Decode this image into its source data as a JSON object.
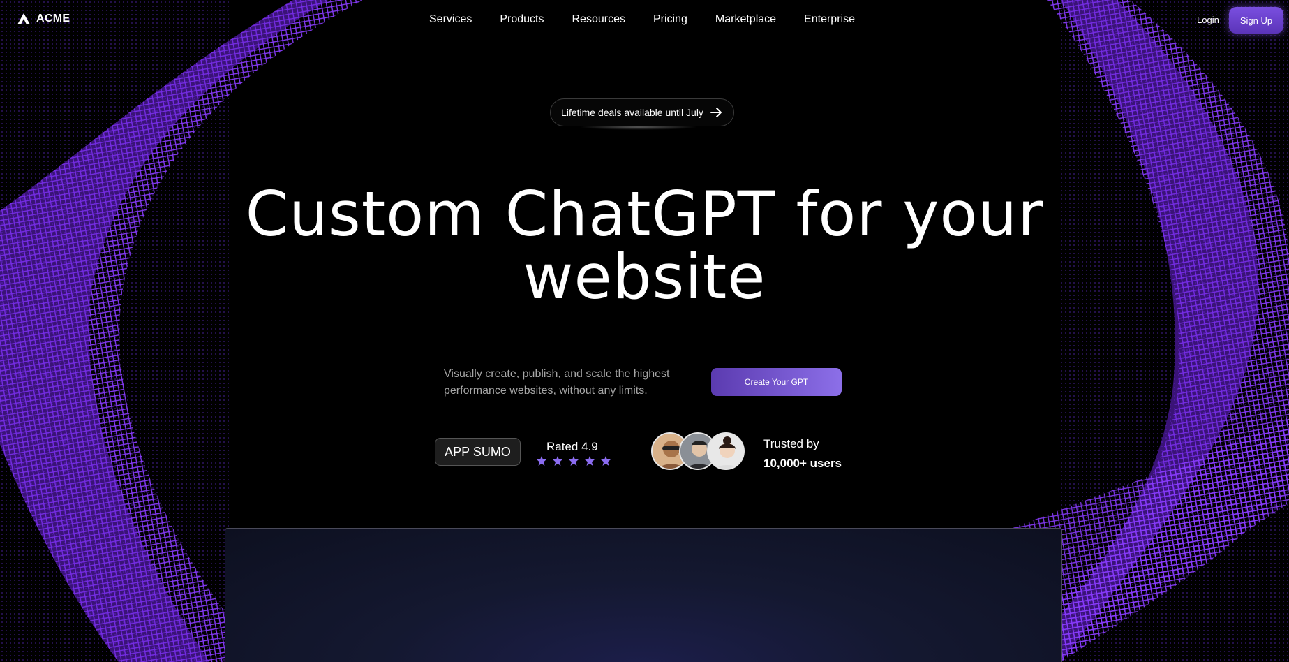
{
  "nav": {
    "logo_text": "ACME",
    "links": [
      "Services",
      "Products",
      "Resources",
      "Pricing",
      "Marketplace",
      "Enterprise"
    ],
    "login_label": "Login",
    "signup_label": "Sign Up"
  },
  "hero": {
    "announcement": "Lifetime deals available until July",
    "headline_line1": "Custom ChatGPT for your",
    "headline_line2": "website",
    "subtext": "Visually create, publish, and scale the highest performance websites, without any limits.",
    "cta_label": "Create Your GPT"
  },
  "social_proof": {
    "badge": "APP SUMO",
    "rating_text": "Rated 4.9",
    "stars": 5,
    "trusted_line1": "Trusted by",
    "trusted_line2": "10,000+ users"
  },
  "colors": {
    "accent": "#7a4fe0",
    "wave": "#7b2ff0",
    "star": "#8b6cf0",
    "background": "#000000"
  },
  "icons": {
    "logo": "acme-logo-icon",
    "arrow": "arrow-right-icon",
    "star": "star-icon"
  }
}
